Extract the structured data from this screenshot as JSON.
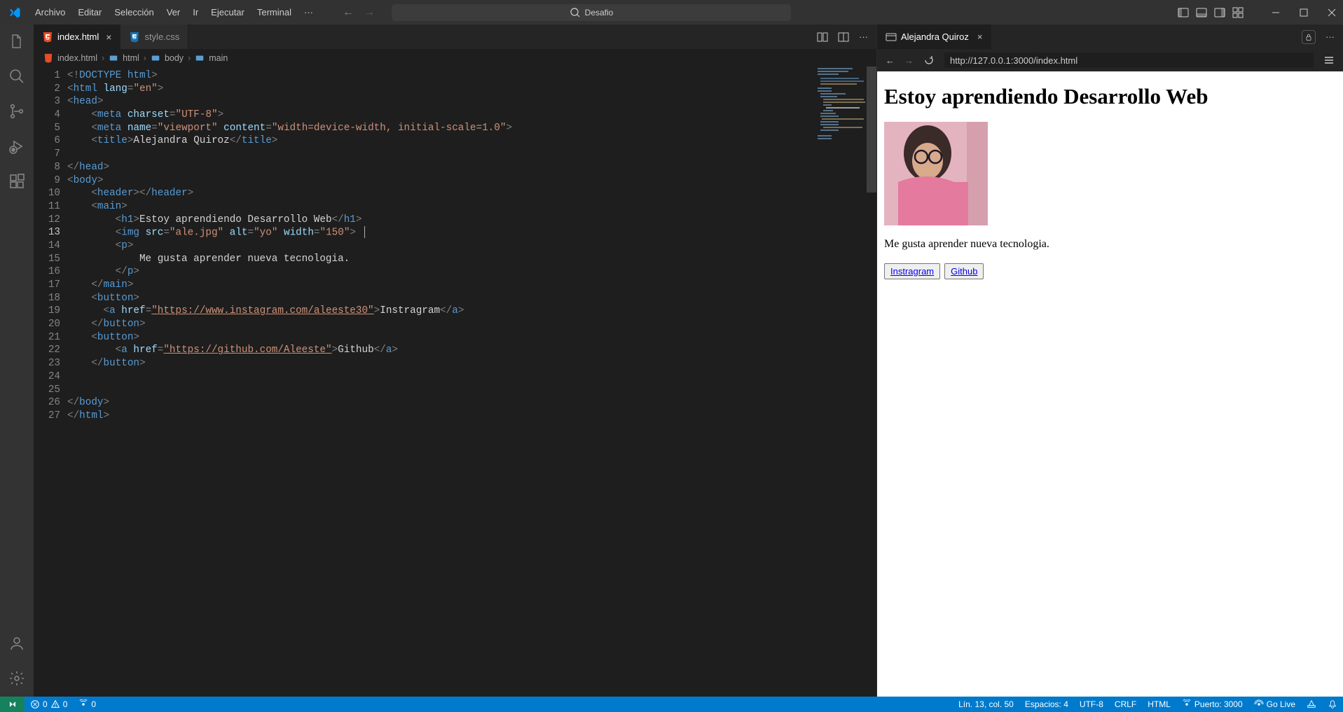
{
  "menu": {
    "items": [
      "Archivo",
      "Editar",
      "Selección",
      "Ver",
      "Ir",
      "Ejecutar",
      "Terminal"
    ],
    "overflow": "···"
  },
  "search": {
    "text": "Desafio"
  },
  "tabs": {
    "left": [
      {
        "label": "index.html",
        "active": true
      },
      {
        "label": "style.css",
        "active": false
      }
    ],
    "right": [
      {
        "label": "Alejandra Quiroz"
      }
    ]
  },
  "breadcrumb": {
    "file": "index.html",
    "path": [
      "html",
      "body",
      "main"
    ]
  },
  "code_lines": 27,
  "current_line": 13,
  "code": {
    "l1": {
      "pre": "<!",
      "doctype": "DOCTYPE",
      "txt": " html",
      "post": ">"
    },
    "l2": {
      "tag": "html",
      "attr": "lang",
      "val": "\"en\""
    },
    "l3": {
      "tag": "head"
    },
    "l5": {
      "tag": "meta",
      "attr": "charset",
      "val": "\"UTF-8\""
    },
    "l6": {
      "tag": "meta",
      "attr1": "name",
      "val1": "\"viewport\"",
      "attr2": "content",
      "val2": "\"width=device-width, initial-scale=1.0\""
    },
    "l7": {
      "tag": "title",
      "text": "Alejandra Quiroz"
    },
    "l9": {
      "tag": "head"
    },
    "l10": {
      "tag": "body"
    },
    "l11": {
      "tag": "header"
    },
    "l12": {
      "tag": "main"
    },
    "l12b": {
      "tag": "h1",
      "text": "Estoy aprendiendo Desarrollo Web"
    },
    "l13": {
      "tag": "img",
      "attr1": "src",
      "val1": "\"ale.jpg\"",
      "attr2": "alt",
      "val2": "\"yo\"",
      "attr3": "width",
      "val3": "\"150\""
    },
    "l14": {
      "tag": "p"
    },
    "l15": {
      "text": "Me gusta aprender nueva tecnologia."
    },
    "l16": {
      "tag": "p"
    },
    "l17": {
      "tag": "main"
    },
    "l18": {
      "tag": "button"
    },
    "l19": {
      "tag": "a",
      "attr": "href",
      "val": "\"https://www.instagram.com/aleeste30\"",
      "text": "Instragram"
    },
    "l20": {
      "tag": "button"
    },
    "l21": {
      "tag": "button"
    },
    "l22": {
      "tag": "a",
      "attr": "href",
      "val": "\"https://github.com/Aleeste\"",
      "text": "Github"
    },
    "l23": {
      "tag": "button"
    },
    "l26": {
      "tag": "body"
    },
    "l27": {
      "tag": "html"
    }
  },
  "preview": {
    "url": "http://127.0.0.1:3000/index.html",
    "h1": "Estoy aprendiendo Desarrollo Web",
    "p": "Me gusta aprender nueva tecnologia.",
    "btn1": "Instragram",
    "btn2": "Github"
  },
  "status": {
    "errors": "0",
    "warnings": "0",
    "ports": "0",
    "position": "Lín. 13, col. 50",
    "spaces": "Espacios: 4",
    "encoding": "UTF-8",
    "eol": "CRLF",
    "lang": "HTML",
    "port": "Puerto: 3000",
    "golive": "Go Live"
  }
}
